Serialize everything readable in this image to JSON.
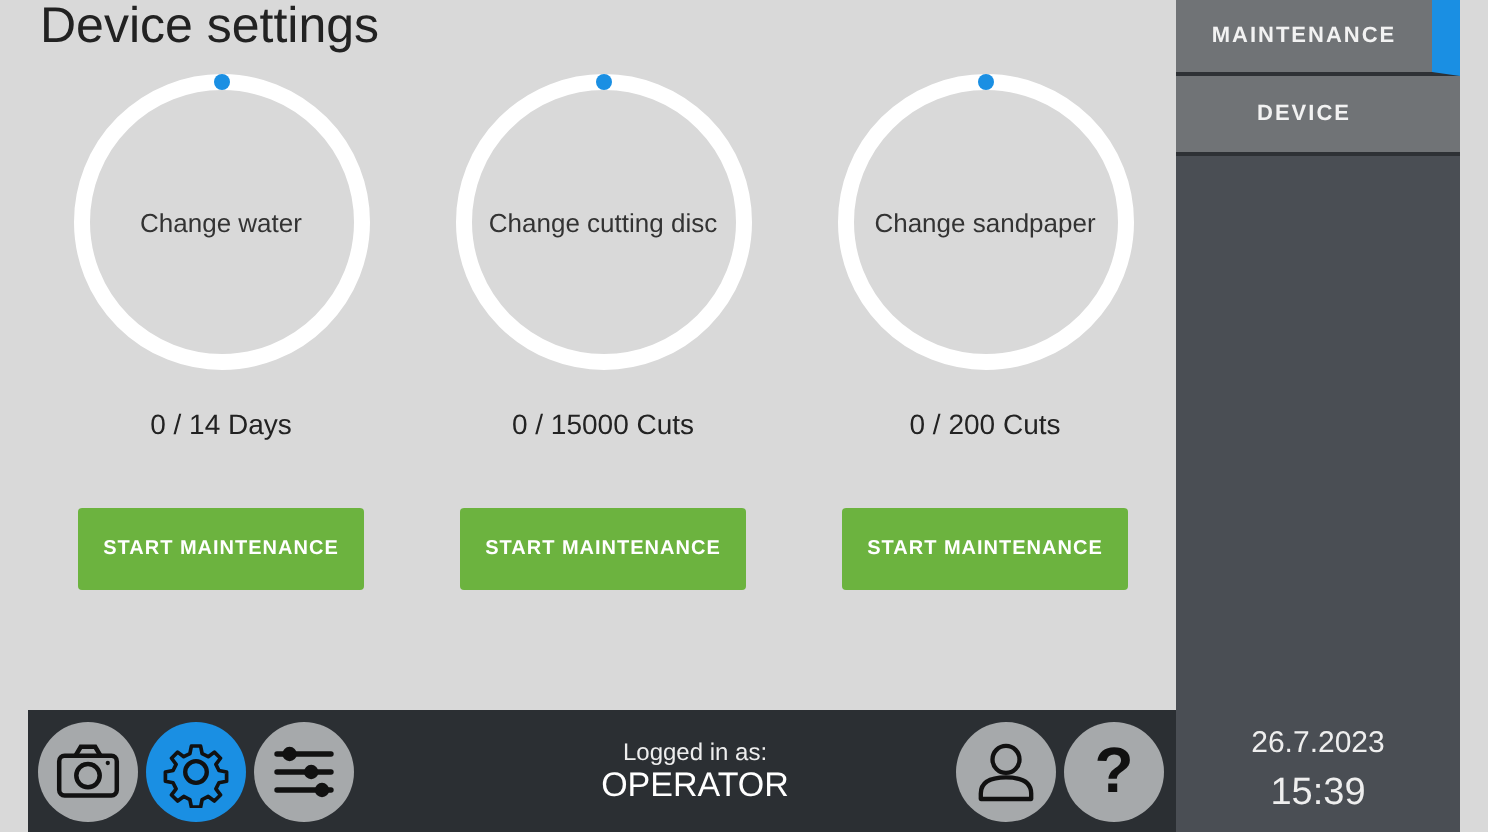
{
  "page": {
    "title": "Device settings"
  },
  "gauges": [
    {
      "label": "Change water",
      "count": "0 / 14 Days",
      "button": "START MAINTENANCE"
    },
    {
      "label": "Change cutting disc",
      "count": "0 / 15000 Cuts",
      "button": "START MAINTENANCE"
    },
    {
      "label": "Change sandpaper",
      "count": "0 / 200 Cuts",
      "button": "START MAINTENANCE"
    }
  ],
  "sidebar": {
    "tabs": [
      {
        "label": "MAINTENANCE",
        "selected": true
      },
      {
        "label": "DEVICE",
        "selected": false
      }
    ],
    "date": "26.7.2023",
    "time": "15:39"
  },
  "bottom_bar": {
    "nav": [
      {
        "kind": "camera",
        "selected": false
      },
      {
        "kind": "settings",
        "selected": true
      },
      {
        "kind": "sliders",
        "selected": false
      }
    ],
    "login_label": "Logged in as:",
    "user": "OPERATOR",
    "help": "?"
  }
}
